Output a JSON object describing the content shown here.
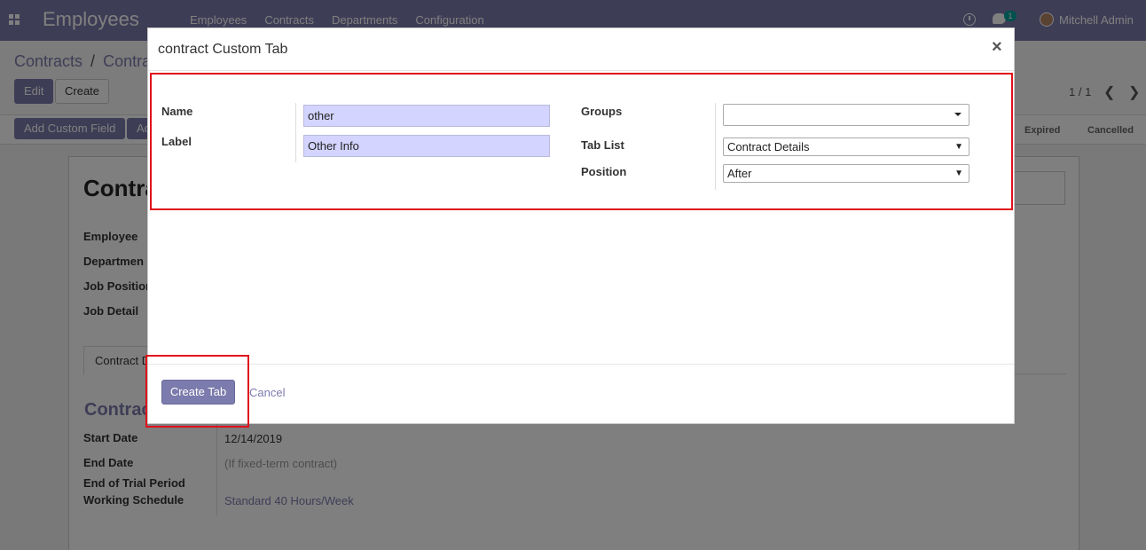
{
  "navbar": {
    "app_title": "Employees",
    "menu": [
      "Employees",
      "Contracts",
      "Departments",
      "Configuration"
    ],
    "chat_badge": "1",
    "user_name": "Mitchell Admin"
  },
  "control_panel": {
    "breadcrumb_root": "Contracts",
    "breadcrumb_sep": "/",
    "breadcrumb_current": "Contrac",
    "edit_label": "Edit",
    "create_label": "Create",
    "pager": "1 / 1",
    "add_custom_field": "Add Custom Field",
    "add_custom_tab_partial": "Ad"
  },
  "status_stages": [
    "Expired",
    "Cancelled"
  ],
  "sheet": {
    "title_partial": "Contra",
    "fields": [
      "Employee",
      "Departmen",
      "Job Position",
      "Job Detail"
    ],
    "tab_partial": "Contract D",
    "section_partial": "Contrac",
    "start_date_label": "Start Date",
    "start_date_value": "12/14/2019",
    "end_date_label": "End Date",
    "end_date_placeholder": "(If fixed-term contract)",
    "trial_label": "End of Trial Period",
    "schedule_label": "Working Schedule",
    "schedule_value": "Standard 40 Hours/Week"
  },
  "modal": {
    "title": "contract Custom Tab",
    "close_glyph": "×",
    "name_label": "Name",
    "name_value": "other",
    "label_label": "Label",
    "label_value": "Other Info",
    "groups_label": "Groups",
    "tab_list_label": "Tab List",
    "tab_list_value": "Contract Details",
    "position_label": "Position",
    "position_value": "After",
    "create_tab_label": "Create Tab",
    "cancel_label": "Cancel"
  },
  "colors": {
    "brand": "#7c7bad",
    "highlight": "#e0101a",
    "input_bg": "#d3d4ff"
  }
}
